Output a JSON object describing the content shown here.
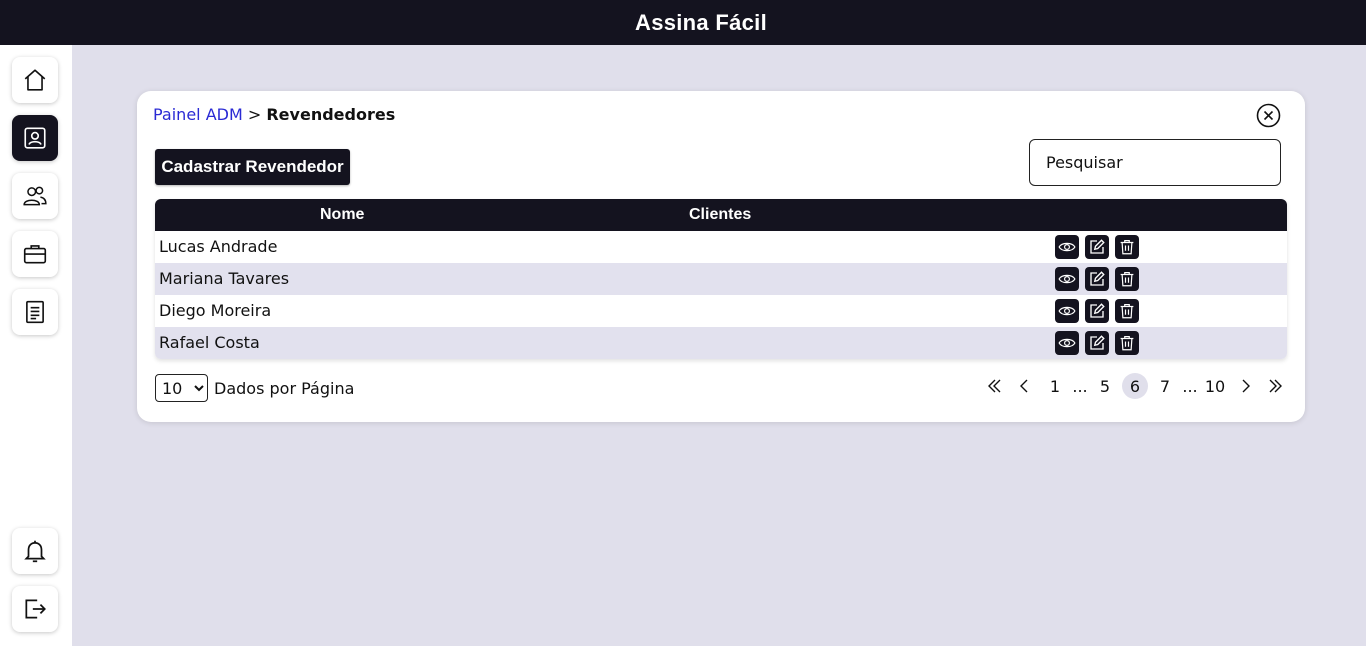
{
  "app": {
    "title": "Assina Fácil"
  },
  "sidebar": {
    "items": [
      {
        "icon": "home-icon"
      },
      {
        "icon": "id-badge-icon",
        "active": true
      },
      {
        "icon": "users-icon"
      },
      {
        "icon": "briefcase-icon"
      },
      {
        "icon": "document-icon"
      },
      {
        "icon": "bell-icon"
      },
      {
        "icon": "logout-icon"
      }
    ]
  },
  "breadcrumb": {
    "parent": "Painel ADM",
    "separator": ">",
    "current": "Revendedores"
  },
  "toolbar": {
    "register_label": "Cadastrar Revendedor",
    "search_placeholder": "Pesquisar"
  },
  "table": {
    "columns": [
      "Nome",
      "Clientes"
    ],
    "rows": [
      {
        "name": "Lucas Andrade",
        "clients": ""
      },
      {
        "name": "Mariana Tavares",
        "clients": ""
      },
      {
        "name": "Diego Moreira",
        "clients": ""
      },
      {
        "name": "Rafael Costa",
        "clients": ""
      }
    ]
  },
  "pagination": {
    "per_page_value": "10",
    "per_page_label": "Dados por Página",
    "pages": [
      "1",
      "...",
      "5",
      "6",
      "7",
      "...",
      "10"
    ],
    "current_page": "6"
  },
  "colors": {
    "dark": "#14131f",
    "background": "#e0dfeb",
    "link": "#2a2ad4"
  }
}
